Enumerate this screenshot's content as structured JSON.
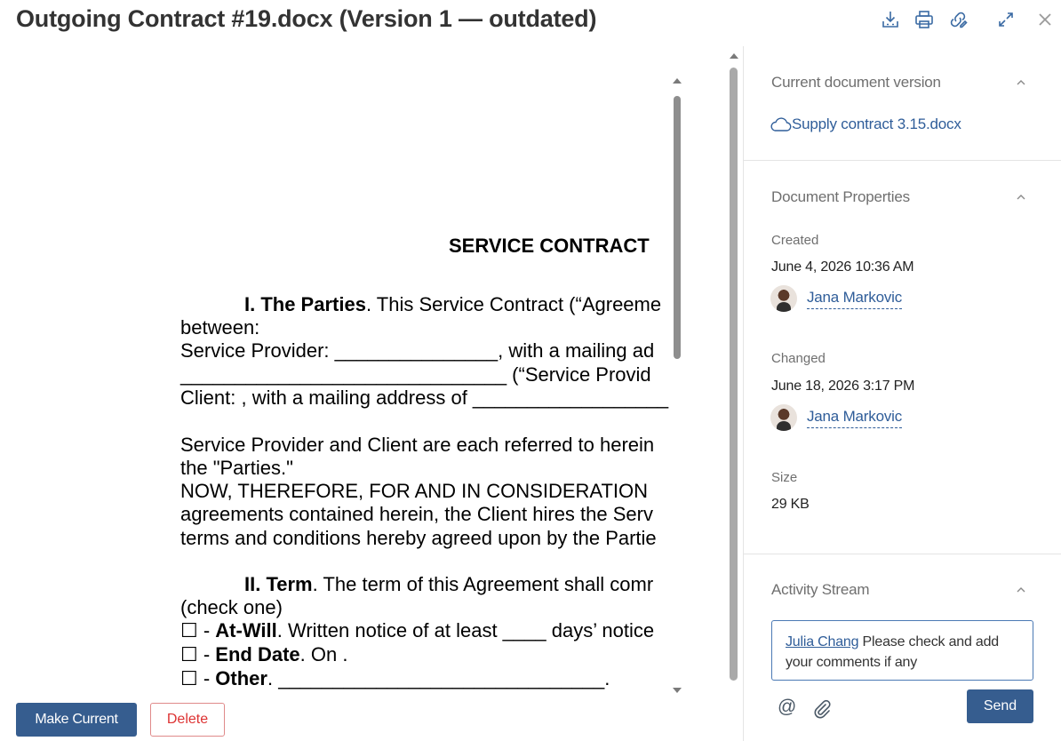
{
  "header": {
    "title": "Outgoing Contract #19.docx (Version 1 — outdated)"
  },
  "toolbar": {
    "download_icon": "download-icon",
    "print_icon": "printer-icon",
    "link_icon": "edit-link-icon",
    "expand_icon": "expand-icon",
    "close_icon": "close-icon"
  },
  "document": {
    "heading": "SERVICE CONTRACT",
    "lines": [
      {
        "prefix_indent": true,
        "bold": "I. The Parties",
        "text": ". This Service Contract (“Agreeme"
      },
      {
        "text": "between:"
      },
      {
        "text": "Service Provider: _______________, with a mailing ad"
      },
      {
        "text": "______________________________ (“Service Provid"
      },
      {
        "text": "Client: , with a mailing address of __________________"
      },
      {
        "text": ""
      },
      {
        "text": "Service Provider and Client are each referred to herein"
      },
      {
        "text": "the \"Parties.\""
      },
      {
        "text": "NOW, THEREFORE, FOR AND IN CONSIDERATION"
      },
      {
        "text": "agreements contained herein, the Client hires the Serv"
      },
      {
        "text": "terms and conditions hereby agreed upon by the Partie"
      },
      {
        "text": ""
      },
      {
        "prefix_indent": true,
        "bold": "II. Term",
        "text": ". The term of this Agreement shall comr"
      },
      {
        "text": "(check one)"
      },
      {
        "checkbox": "☐ - ",
        "bold": "At-Will",
        "text": ". Written notice of at least ____ days’ notice"
      },
      {
        "checkbox": "☐ - ",
        "bold": "End Date",
        "text": ". On ."
      },
      {
        "checkbox": "☐ - ",
        "bold": "Other",
        "text": ". ______________________________."
      }
    ]
  },
  "actions": {
    "make_current": "Make Current",
    "delete": "Delete"
  },
  "panel": {
    "current_version": {
      "heading": "Current document version",
      "file_name": "Supply contract 3.15.docx",
      "file_icon": "cloud-icon"
    },
    "properties": {
      "heading": "Document Properties",
      "created_label": "Created",
      "created_value": "June 4, 2026 10:36 AM",
      "created_by": "Jana Markovic",
      "changed_label": "Changed",
      "changed_value": "June 18, 2026 3:17 PM",
      "changed_by": "Jana Markovic",
      "size_label": "Size",
      "size_value": "29 KB"
    },
    "activity": {
      "heading": "Activity Stream",
      "mention": "Julia Chang",
      "comment_text": " Please check and add your comments if any",
      "send": "Send",
      "at_icon": "@",
      "attach_icon": "paperclip-icon"
    }
  },
  "colors": {
    "accent": "#365d8f",
    "link": "#2f5d99",
    "danger": "#dd3333"
  }
}
